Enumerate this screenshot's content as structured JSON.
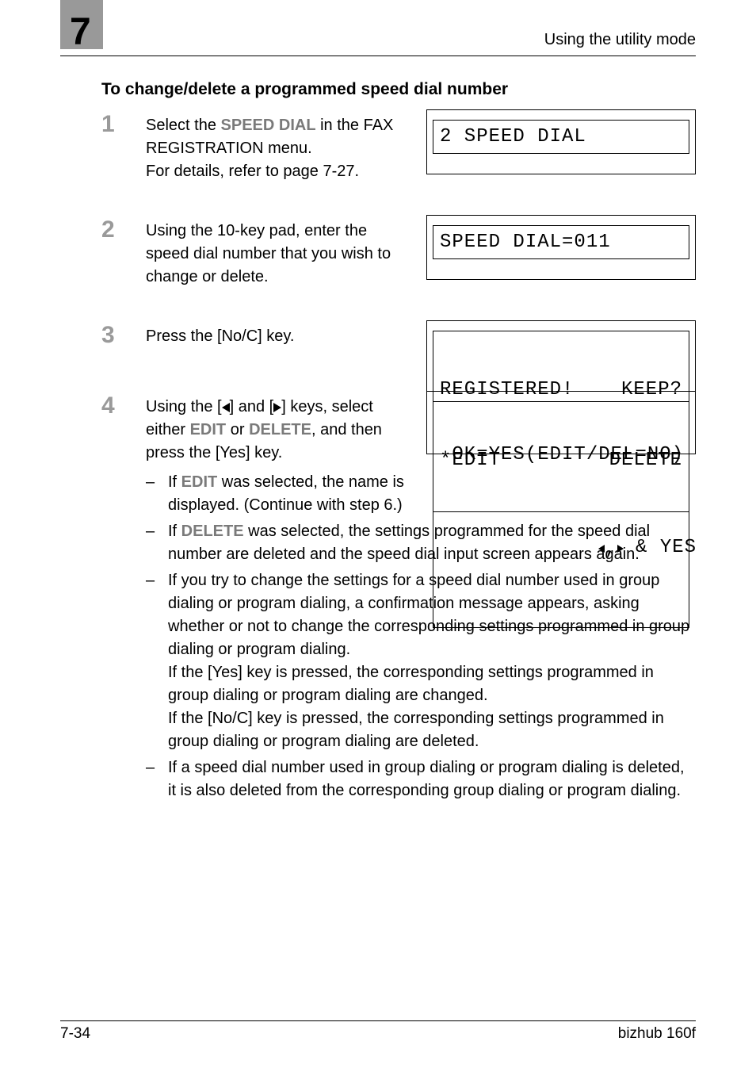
{
  "chapter_number": "7",
  "running_header": "Using the utility mode",
  "section_title": "To change/delete a programmed speed dial number",
  "steps": {
    "s1": {
      "num": "1",
      "line1a": "Select the ",
      "hl1": "SPEED DIAL",
      "line1b": " in the FAX REGISTRATION menu.",
      "line2": "For details, refer to page 7-27.",
      "lcd": "2 SPEED DIAL"
    },
    "s2": {
      "num": "2",
      "text": "Using the 10-key pad, enter the speed dial number that you wish to change or delete.",
      "lcd": "SPEED DIAL=011"
    },
    "s3": {
      "num": "3",
      "text": "Press the [No/C] key.",
      "lcd_l1_left": "REGISTERED!",
      "lcd_l1_right": "KEEP?",
      "lcd_l2": " OK=YES(EDIT/DEL=NO)"
    },
    "s4": {
      "num": "4",
      "line1a": "Using the [",
      "line1b": "] and [",
      "line1c": "] keys, select either ",
      "hl_edit": "EDIT",
      "mid": " or ",
      "hl_delete": "DELETE",
      "line1d": ", and then press the [Yes] key.",
      "lcd_left": "*EDIT",
      "lcd_right": "DELETE",
      "lcd_bottom": " & YES",
      "bullets": {
        "b1a": "If ",
        "b1hl": "EDIT",
        "b1b": " was selected, the name is displayed. (Continue with step 6.)",
        "b2a": "If ",
        "b2hl": "DELETE",
        "b2b": " was selected, the settings programmed for the speed dial number are deleted and the speed dial input screen appears again.",
        "b3": "If you try to change the settings for a speed dial number used in group dialing or program dialing, a confirmation message appears, asking whether or not to change the corresponding settings programmed in group dialing or program dialing.",
        "b3p2": "If the [Yes] key is pressed, the corresponding settings programmed in group dialing or program dialing are changed.",
        "b3p3": "If the [No/C] key is pressed, the corresponding settings programmed in group dialing or program dialing are deleted.",
        "b4": "If a speed dial number used in group dialing or program dialing is deleted, it is also deleted from the corresponding group dialing or program dialing."
      }
    }
  },
  "footer": {
    "left": "7-34",
    "right": "bizhub 160f"
  }
}
